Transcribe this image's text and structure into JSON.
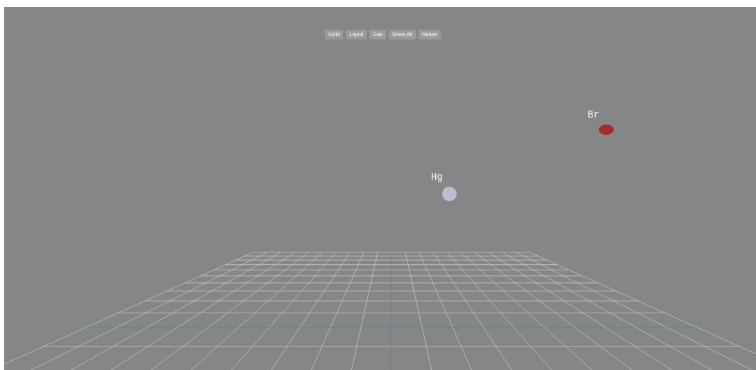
{
  "toolbar": {
    "buttons": [
      {
        "label": "Solid"
      },
      {
        "label": "Liquid"
      },
      {
        "label": "Gas"
      },
      {
        "label": "Show All"
      },
      {
        "label": "Return"
      }
    ]
  },
  "elements": [
    {
      "symbol": "Br",
      "color": "#a52a2a"
    },
    {
      "symbol": "Hg",
      "color": "#bdbdd6"
    }
  ]
}
